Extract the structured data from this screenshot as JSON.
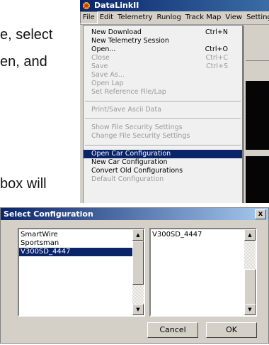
{
  "document": {
    "line1": "e, select",
    "line2": "en,  and",
    "line3": "box will"
  },
  "app": {
    "title": "DataLinkII",
    "menu": [
      "File",
      "Edit",
      "Telemetry",
      "Runlog",
      "Track Map",
      "View",
      "Settings"
    ],
    "file_menu": {
      "new_download": "New Download",
      "new_download_shortcut": "Ctrl+N",
      "new_telemetry_session": "New Telemetry Session",
      "open": "Open...",
      "open_shortcut": "Ctrl+O",
      "close": "Close",
      "close_shortcut": "Ctrl+C",
      "save": "Save",
      "save_shortcut": "Ctrl+S",
      "save_as": "Save As...",
      "open_lap": "Open Lap",
      "set_reference_file_lap": "Set Reference File/Lap",
      "print_save_ascii": "Print/Save Ascii Data",
      "show_file_security": "Show File Security Settings",
      "change_file_security": "Change File Security Settings",
      "open_car_configuration": "Open Car Configuration",
      "new_car_configuration": "New Car Configuration",
      "convert_old_configurations": "Convert Old Configurations",
      "default_configuration": "Default Configuration"
    }
  },
  "dialog": {
    "title": "Select Configuration",
    "close_glyph": "x",
    "left_list": [
      "SmartWire",
      "Sportsman",
      "V300SD_4447"
    ],
    "left_selected": "V300SD_4447",
    "right_list": [
      "V300SD_4447"
    ],
    "cancel_label": "Cancel",
    "ok_label": "OK"
  },
  "icons": {
    "app_logo": "datalink-logo-icon",
    "scroll_up": "scroll-up-arrow-icon",
    "scroll_down": "scroll-down-arrow-icon"
  },
  "colors": {
    "title_bar": "#0a246a",
    "selection": "#0a246a",
    "window_face": "#d4d0c8"
  }
}
